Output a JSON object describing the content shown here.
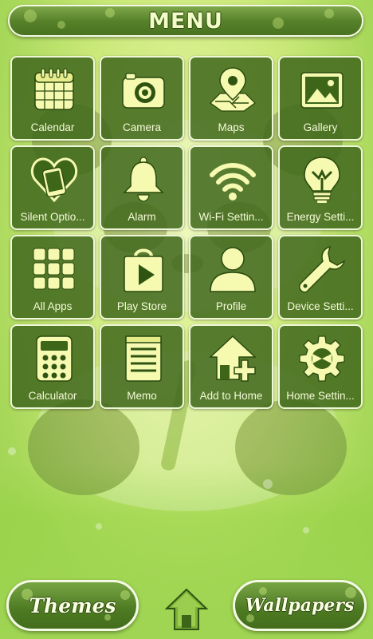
{
  "header": {
    "title": "MENU"
  },
  "tiles": [
    {
      "label": "Calendar",
      "icon": "calendar-icon"
    },
    {
      "label": "Camera",
      "icon": "camera-icon"
    },
    {
      "label": "Maps",
      "icon": "map-pin-icon"
    },
    {
      "label": "Gallery",
      "icon": "picture-icon"
    },
    {
      "label": "Silent Optio...",
      "icon": "heart-phone-icon"
    },
    {
      "label": "Alarm",
      "icon": "bell-icon"
    },
    {
      "label": "Wi-Fi Settin...",
      "icon": "wifi-icon"
    },
    {
      "label": "Energy Setti...",
      "icon": "lightbulb-icon"
    },
    {
      "label": "All Apps",
      "icon": "app-grid-icon"
    },
    {
      "label": "Play Store",
      "icon": "shopping-bag-play-icon"
    },
    {
      "label": "Profile",
      "icon": "person-icon"
    },
    {
      "label": "Device Setti...",
      "icon": "wrench-icon"
    },
    {
      "label": "Calculator",
      "icon": "calculator-icon"
    },
    {
      "label": "Memo",
      "icon": "notepad-icon"
    },
    {
      "label": "Add to Home",
      "icon": "house-plus-icon"
    },
    {
      "label": "Home Settin...",
      "icon": "gear-icon"
    }
  ],
  "bottom": {
    "themes_label": "Themes",
    "wallpapers_label": "Wallpapers",
    "home_icon": "home-arrow-icon"
  },
  "colors": {
    "tile_bg": "#40681c",
    "icon_fill": "#f6f9b0",
    "text": "#f5fad8",
    "background": "#cbe97a"
  }
}
